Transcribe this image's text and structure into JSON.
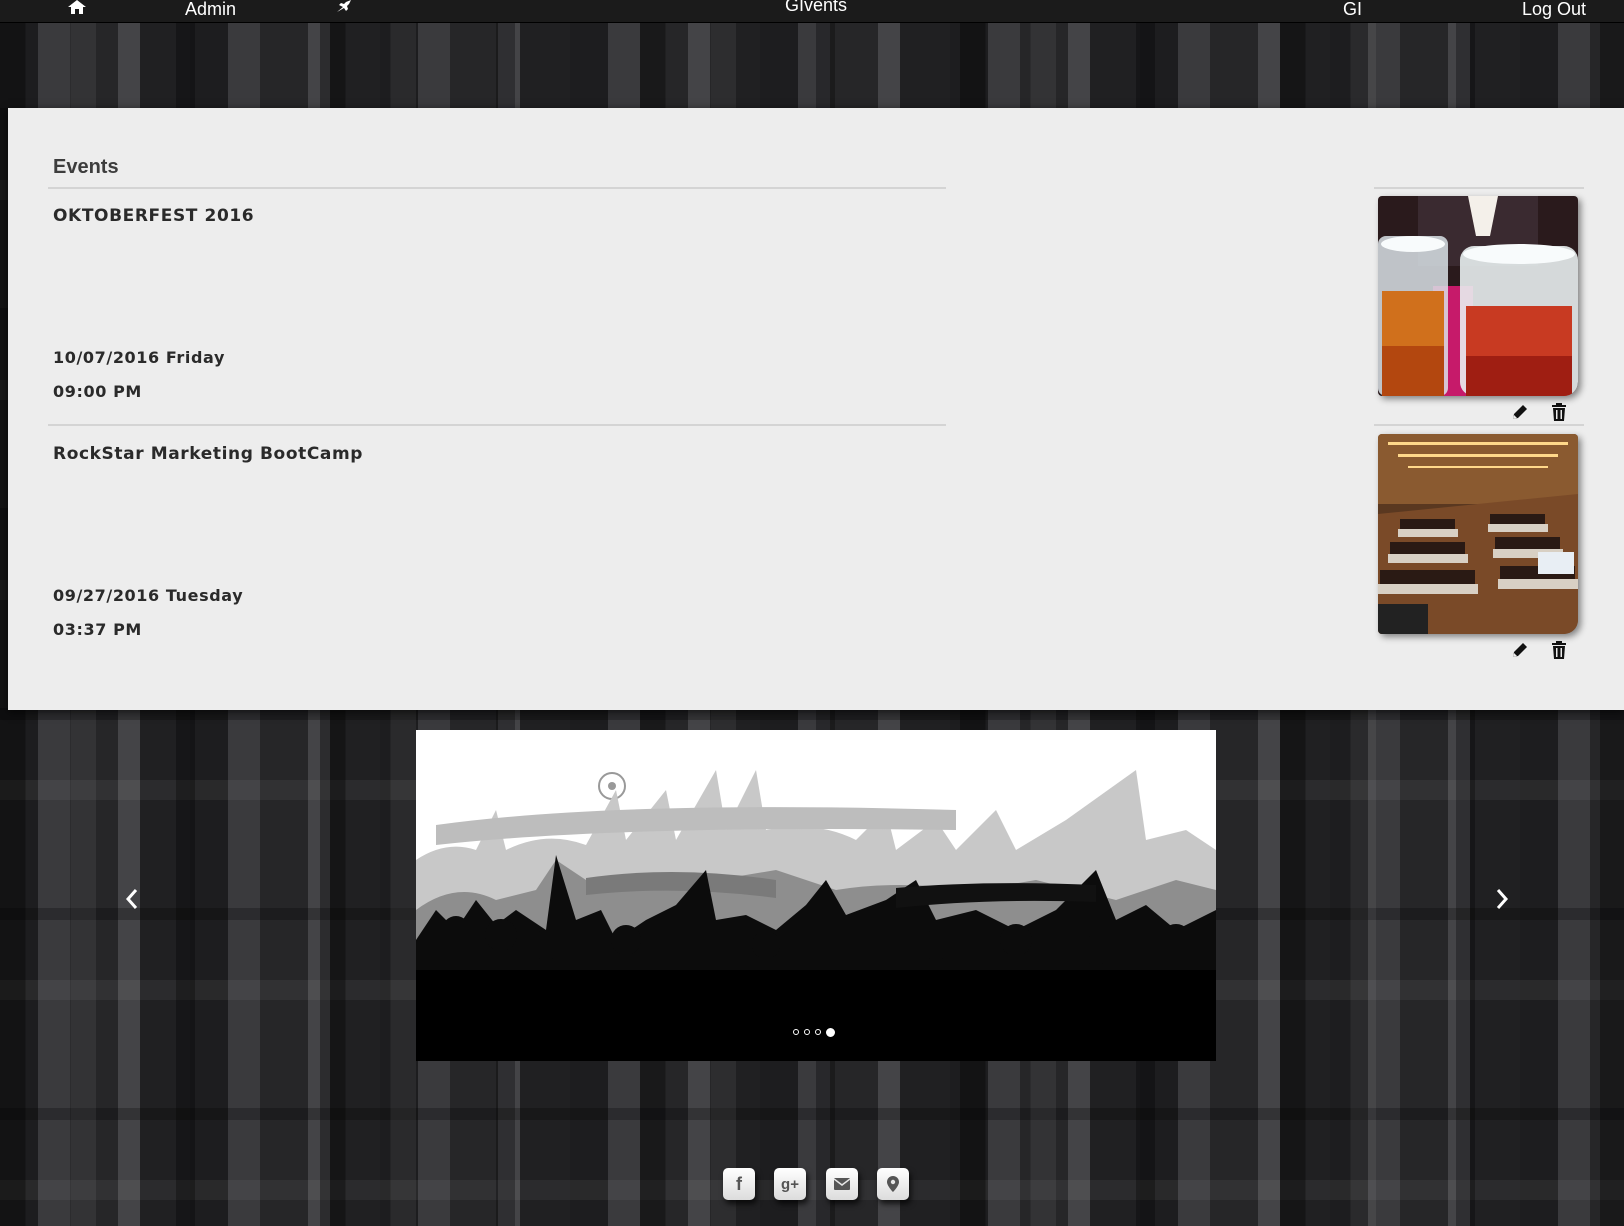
{
  "nav": {
    "home_icon": "home-icon",
    "admin_label": "Admin",
    "pin_icon": "pushpin-icon",
    "brand_label": "GIvents",
    "user_label": "GI",
    "logout_label": "Log Out"
  },
  "events": {
    "heading": "Events",
    "items": [
      {
        "name": "OKTOBERFEST 2016",
        "date": "10/07/2016 Friday",
        "time": "09:00 PM",
        "image": "beer-mugs-photo"
      },
      {
        "name": "RockStar Marketing BootCamp",
        "date": "09/27/2016 Tuesday",
        "time": "03:37 PM",
        "image": "conference-hall-photo"
      }
    ],
    "edit_icon": "pencil-icon",
    "delete_icon": "trash-icon"
  },
  "carousel": {
    "image": "crowd-silhouette-banner",
    "slide_count": 4,
    "active_slide": 4
  },
  "footer": {
    "social": [
      {
        "icon": "facebook-icon",
        "glyph": "f"
      },
      {
        "icon": "google-plus-icon",
        "glyph": "g+"
      },
      {
        "icon": "mail-icon",
        "glyph": ""
      },
      {
        "icon": "map-pin-icon",
        "glyph": ""
      }
    ]
  }
}
